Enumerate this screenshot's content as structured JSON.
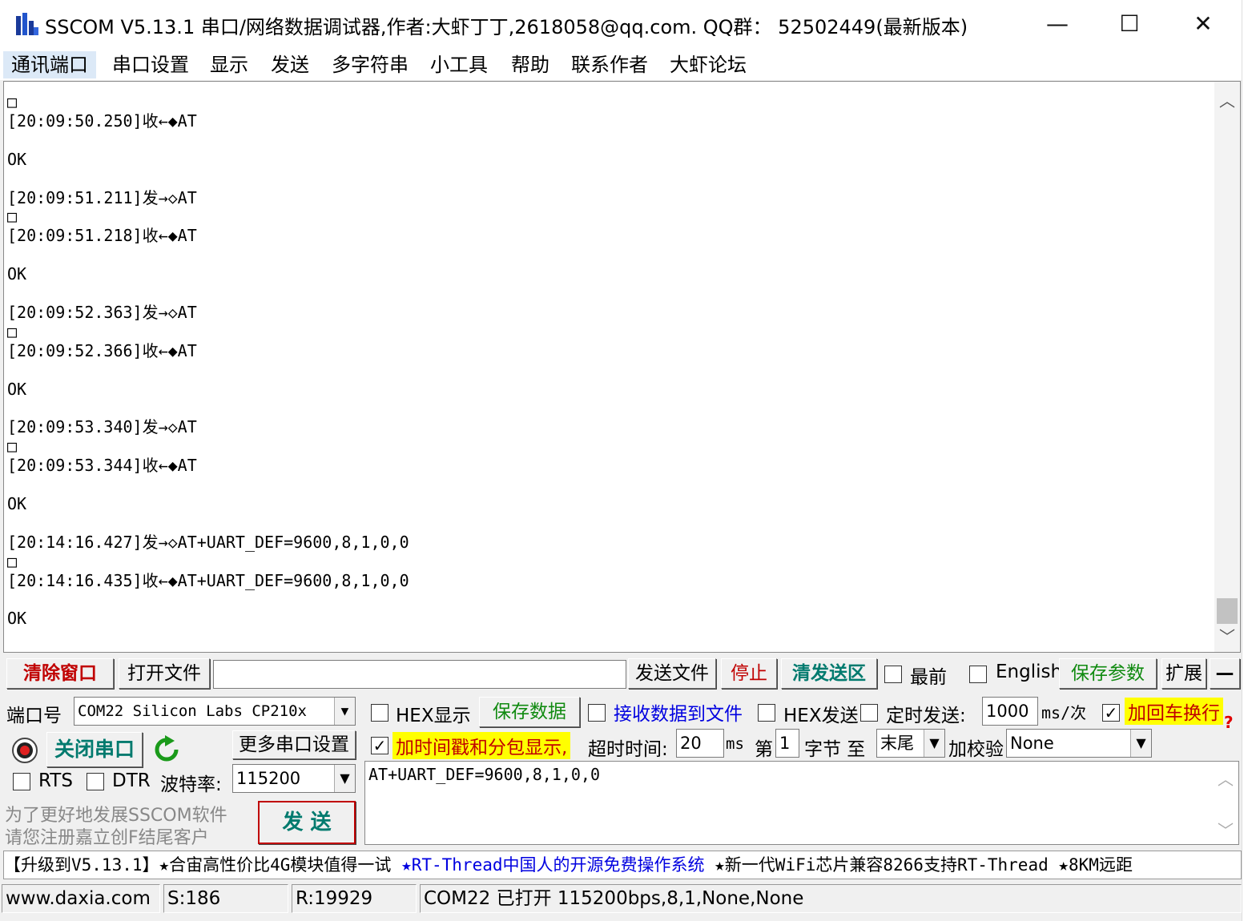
{
  "window": {
    "title": "SSCOM V5.13.1 串口/网络数据调试器,作者:大虾丁丁,2618058@qq.com. QQ群：  52502449(最新版本)",
    "minimize": "—",
    "maximize": "☐",
    "close": "✕"
  },
  "menu": [
    "通讯端口",
    "串口设置",
    "显示",
    "发送",
    "多字符串",
    "小工具",
    "帮助",
    "联系作者",
    "大虾论坛"
  ],
  "receive": {
    "lines": [
      "□",
      "[20:09:50.250]收←◆AT",
      "",
      "OK",
      "",
      "[20:09:51.211]发→◇AT",
      "□",
      "[20:09:51.218]收←◆AT",
      "",
      "OK",
      "",
      "[20:09:52.363]发→◇AT",
      "□",
      "[20:09:52.366]收←◆AT",
      "",
      "OK",
      "",
      "[20:09:53.340]发→◇AT",
      "□",
      "[20:09:53.344]收←◆AT",
      "",
      "OK",
      "",
      "[20:14:16.427]发→◇AT+UART_DEF=9600,8,1,0,0",
      "□",
      "[20:14:16.435]收←◆AT+UART_DEF=9600,8,1,0,0",
      "",
      "OK"
    ]
  },
  "toolbar": {
    "clear_window": "清除窗口",
    "open_file": "打开文件",
    "file_path": "",
    "send_file": "发送文件",
    "stop": "停止",
    "clear_send": "清发送区",
    "topmost_label": "最前",
    "english_label": "English",
    "save_params": "保存参数",
    "expand": "扩展",
    "collapse": "—"
  },
  "port": {
    "port_label": "端口号",
    "port_value": "COM22 Silicon Labs CP210x",
    "close_port": "关闭串口",
    "more_settings": "更多串口设置",
    "rts_label": "RTS",
    "dtr_label": "DTR",
    "baud_label": "波特率:",
    "baud_value": "115200",
    "ad_line1": "为了更好地发展SSCOM软件",
    "ad_line2": "请您注册嘉立创F结尾客户",
    "send": "发  送"
  },
  "options": {
    "hex_display": "HEX显示",
    "save_data": "保存数据",
    "recv_to_file": "接收数据到文件",
    "hex_send": "HEX发送",
    "timed_send": "定时发送:",
    "interval": "1000",
    "interval_unit": "ms/次",
    "add_crlf": "加回车换行",
    "add_crlf_checked": true,
    "timestamp_label": "加时间戳和分包显示,",
    "timestamp_checked": true,
    "timeout_label": "超时时间:",
    "timeout_value": "20",
    "timeout_unit": "ms",
    "byte_from_label": "第",
    "byte_from": "1",
    "byte_unit": "字节 至",
    "byte_to": "末尾",
    "checksum_label": "加校验",
    "checksum_value": "None"
  },
  "send_text": "AT+UART_DEF=9600,8,1,0,0",
  "ticker": {
    "part1": "【升级到V5.13.1】★合宙高性价比4G模块值得一试 ",
    "part2": "★RT-Thread中国人的开源免费操作系统",
    "part3": " ★新一代WiFi芯片兼容8266支持RT-Thread ★8KM远距"
  },
  "status": {
    "website": "www.daxia.com",
    "sent": "S:186",
    "received": "R:19929",
    "port_status": "COM22 已打开  115200bps,8,1,None,None"
  },
  "colors": {
    "red_text": "#c00000",
    "green_text": "#108a10",
    "teal_text": "#007a6e",
    "blue_text": "#0000e0",
    "highlight_yellow": "#ffff00"
  }
}
